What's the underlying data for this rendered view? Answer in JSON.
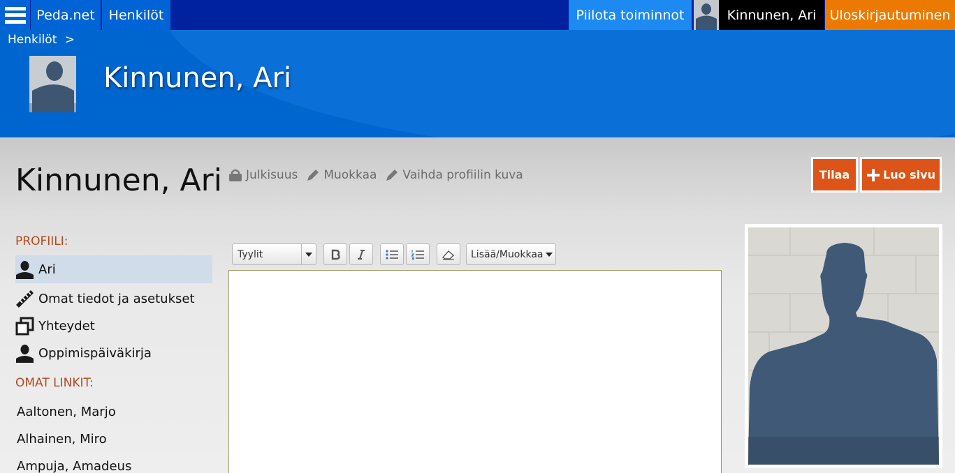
{
  "topbar": {
    "menu_icon": "hamburger-icon",
    "site_name": "Peda.net",
    "section": "Henkilöt",
    "hide_actions": "Piilota toiminnot",
    "user_name": "Kinnunen, Ari",
    "logout": "Uloskirjautuminen"
  },
  "header": {
    "breadcrumb": "Henkilöt",
    "breadcrumb_sep": ">",
    "title": "Kinnunen, Ari"
  },
  "page": {
    "title": "Kinnunen, Ari",
    "actions": {
      "visibility": "Julkisuus",
      "edit": "Muokkaa",
      "change_picture": "Vaihda profiilin kuva"
    },
    "buttons": {
      "order": "Tilaa",
      "create_page": "Luo sivu"
    }
  },
  "sidebar": {
    "profile_heading": "PROFIILI:",
    "profile_items": [
      {
        "label": "Ari",
        "icon": "person-icon"
      },
      {
        "label": "Omat tiedot ja asetukset",
        "icon": "ruler-icon"
      },
      {
        "label": "Yhteydet",
        "icon": "connections-icon"
      },
      {
        "label": "Oppimispäiväkirja",
        "icon": "person-icon"
      }
    ],
    "links_heading": "OMAT LINKIT:",
    "links": [
      "Aaltonen, Marjo",
      "Alhainen, Miro",
      "Ampuja, Amadeus"
    ]
  },
  "editor": {
    "styles_select": "Tyylit",
    "insert_select": "Lisää/Muokkaa"
  },
  "colors": {
    "topbar": "#0021a0",
    "nav_blue": "#0064d6",
    "header": "#0066cf",
    "logout": "#ec7a00",
    "button_orange": "#dd5418",
    "section_heading": "#b34a1f"
  }
}
